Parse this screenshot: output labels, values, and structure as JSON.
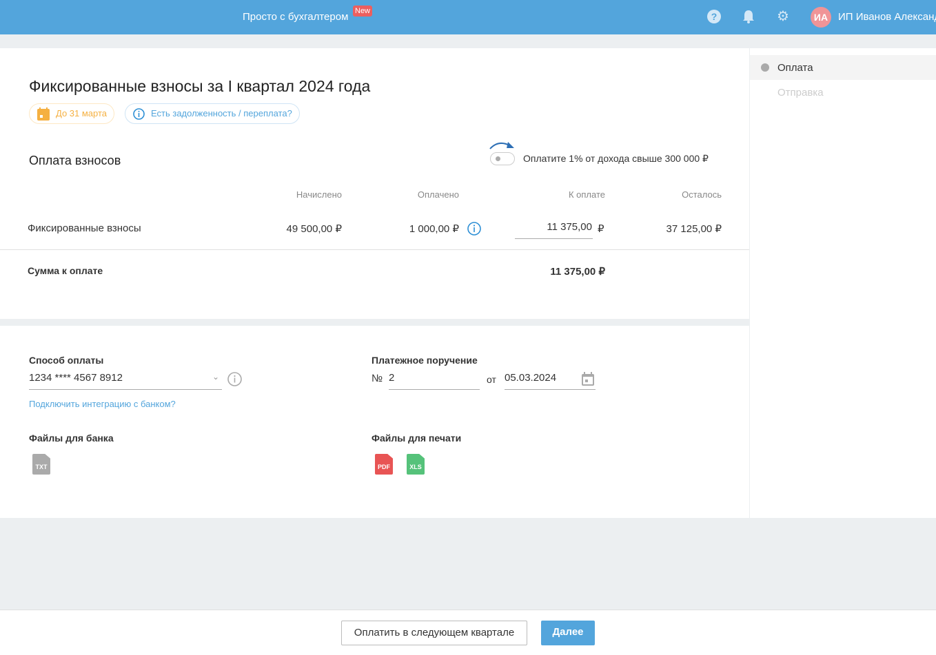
{
  "header": {
    "title": "Просто с бухгалтером",
    "new_badge": "New",
    "avatar_initials": "ИА",
    "user_name": "ИП Иванов Александр"
  },
  "page": {
    "title": "Фиксированные взносы за I квартал 2024 года",
    "deadline": "До 31 марта",
    "debt_link": "Есть задолженность / переплата?"
  },
  "payment": {
    "section_title": "Оплата взносов",
    "toggle_label": "Оплатите 1% от дохода свыше 300 000 ₽",
    "toggle_on": false,
    "columns": [
      "Начислено",
      "Оплачено",
      "К оплате",
      "Осталось"
    ],
    "row": {
      "name": "Фиксированные взносы",
      "accrued": "49 500,00 ₽",
      "paid": "1 000,00 ₽",
      "to_pay": "11 375,00",
      "currency": "₽",
      "remaining": "37 125,00 ₽"
    },
    "total_label": "Сумма к оплате",
    "total": "11 375,00 ₽"
  },
  "method": {
    "label": "Способ оплаты",
    "value": "1234 **** 4567 8912",
    "bank_link": "Подключить интеграцию с банком?"
  },
  "order": {
    "label": "Платежное поручение",
    "number_prefix": "№",
    "number": "2",
    "date_prefix": "от",
    "date": "05.03.2024"
  },
  "files": {
    "bank_label": "Файлы для банка",
    "print_label": "Файлы для печати",
    "txt": "TXT",
    "pdf": "PDF",
    "xls": "XLS"
  },
  "steps": [
    {
      "label": "Оплата"
    },
    {
      "label": "Отправка"
    }
  ],
  "footer": {
    "next_quarter": "Оплатить в следующем квартале",
    "next": "Далее"
  }
}
